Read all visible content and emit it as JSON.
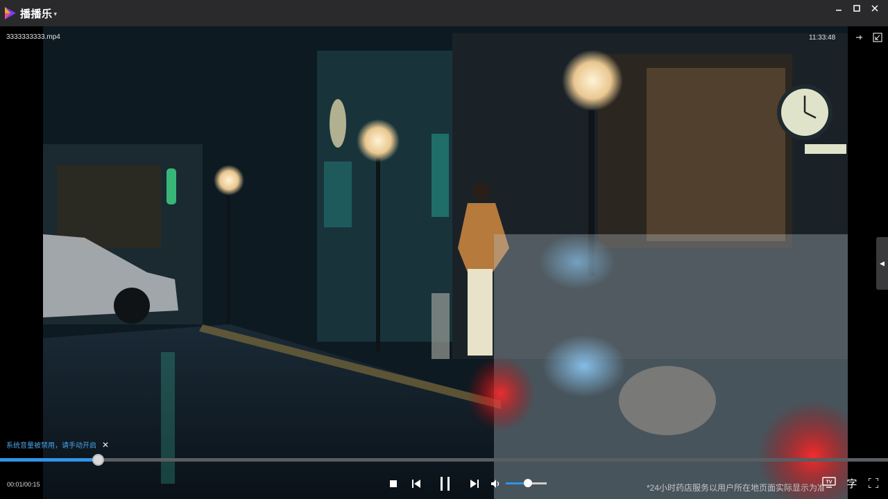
{
  "app": {
    "logo_text": "播播乐",
    "caret": "▾"
  },
  "window": {
    "minimize": "—",
    "maximize": "☐",
    "close": "✕"
  },
  "video": {
    "file_name": "3333333333.mp4",
    "clock": "11:33:48"
  },
  "notice": {
    "text": "系统音量被禁用，请手动开启",
    "close": "✕"
  },
  "playback": {
    "current": "00:01",
    "duration": "00:15",
    "separator": "/",
    "progress_fraction": 0.11
  },
  "volume": {
    "level_fraction": 0.55
  },
  "overlay": {
    "disclaimer": "*24小时药店服务以用户所在地页面实际显示为准"
  },
  "controls": {
    "subtitle_label": "字",
    "tv_label": "TV"
  },
  "colors": {
    "accent": "#2f95e8",
    "titlebar": "#2a2a2d",
    "notice": "#4aa3e6"
  }
}
